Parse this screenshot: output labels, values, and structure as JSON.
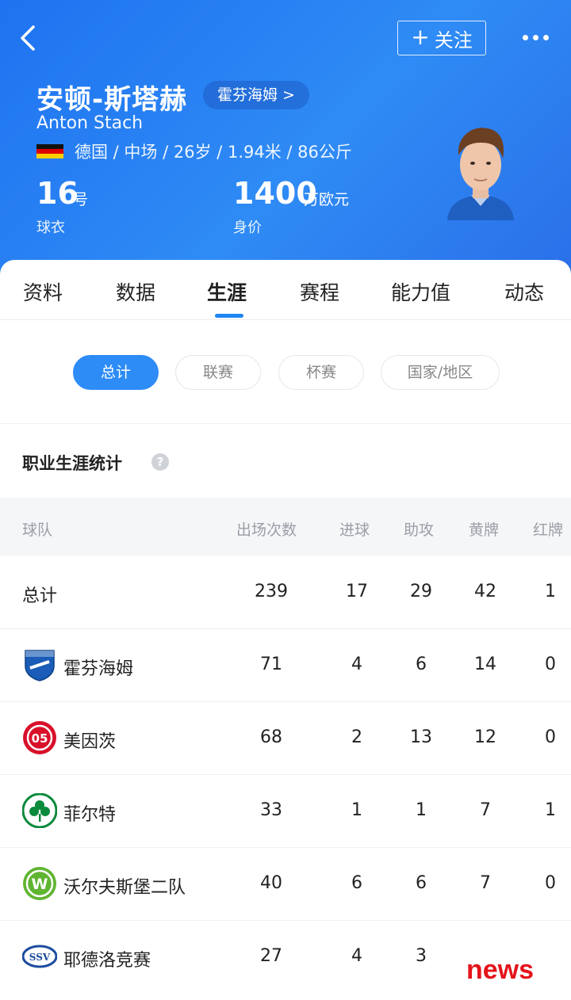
{
  "header": {
    "follow_label": "关注",
    "follow_plus": "+",
    "name_cn": "安顿-斯塔赫",
    "team_link": "霍芬海姆 >",
    "name_en": "Anton Stach",
    "meta": "德国 / 中场 / 26岁 / 1.94米 / 86公斤",
    "shirt_number": "16",
    "shirt_unit": "号",
    "shirt_label": "球衣",
    "value_number": "1400",
    "value_unit": "万欧元",
    "value_label": "身价",
    "brand_color": "#2a7ff0"
  },
  "tabs": [
    "资料",
    "数据",
    "生涯",
    "赛程",
    "能力值",
    "动态"
  ],
  "active_tab": "生涯",
  "filters": [
    "总计",
    "联赛",
    "杯赛",
    "国家/地区"
  ],
  "active_filter": "总计",
  "section_title": "职业生涯统计",
  "table": {
    "headers": [
      "球队",
      "出场次数",
      "进球",
      "助攻",
      "黄牌",
      "红牌"
    ],
    "rows": [
      {
        "team": "总计",
        "logo": "",
        "apps": "239",
        "goals": "17",
        "assists": "29",
        "yellow": "42",
        "red": "1"
      },
      {
        "team": "霍芬海姆",
        "logo": "hoffenheim-logo",
        "apps": "71",
        "goals": "4",
        "assists": "6",
        "yellow": "14",
        "red": "0"
      },
      {
        "team": "美因茨",
        "logo": "mainz-logo",
        "apps": "68",
        "goals": "2",
        "assists": "13",
        "yellow": "12",
        "red": "0"
      },
      {
        "team": "菲尔特",
        "logo": "furth-logo",
        "apps": "33",
        "goals": "1",
        "assists": "1",
        "yellow": "7",
        "red": "1"
      },
      {
        "team": "沃尔夫斯堡二队",
        "logo": "wolfsburg-logo",
        "apps": "40",
        "goals": "6",
        "assists": "6",
        "yellow": "7",
        "red": "0"
      },
      {
        "team": "耶德洛竞赛",
        "logo": "ssv-logo",
        "apps": "27",
        "goals": "4",
        "assists": "3",
        "yellow": "",
        "red": ""
      }
    ]
  },
  "watermark": "news"
}
